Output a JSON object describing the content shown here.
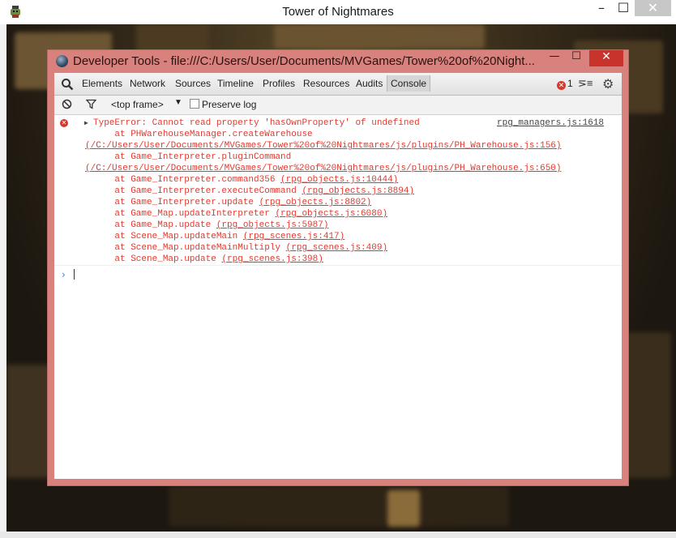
{
  "window": {
    "title": "Tower of Nightmares",
    "controls": {
      "minimize": "–",
      "maximize": "☐",
      "close": "✕"
    }
  },
  "devtools": {
    "title": "Developer Tools - file:///C:/Users/User/Documents/MVGames/Tower%20of%20Night...",
    "controls": {
      "minimize": "—",
      "maximize": "☐",
      "close": "✕"
    },
    "tabs": [
      "Elements",
      "Network",
      "Sources",
      "Timeline",
      "Profiles",
      "Resources",
      "Audits",
      "Console"
    ],
    "active_tab": "Console",
    "error_count": "1",
    "subtoolbar": {
      "frame": "<top frame>",
      "preserve_log": "Preserve log"
    },
    "console": {
      "error": {
        "message": "TypeError: Cannot read property 'hasOwnProperty' of undefined",
        "source": "rpg_managers.js:1618",
        "stack": [
          {
            "text": "    at PHWarehouseManager.createWarehouse",
            "link": ""
          },
          {
            "text": "",
            "link": "(/C:/Users/User/Documents/MVGames/Tower%20of%20Nightmares/js/plugins/PH_Warehouse.js:156)",
            "standalone": true
          },
          {
            "text": "    at Game_Interpreter.pluginCommand",
            "link": ""
          },
          {
            "text": "",
            "link": "(/C:/Users/User/Documents/MVGames/Tower%20of%20Nightmares/js/plugins/PH_Warehouse.js:650)",
            "standalone": true
          },
          {
            "text": "    at Game_Interpreter.command356 ",
            "link": "(rpg_objects.js:10444)"
          },
          {
            "text": "    at Game_Interpreter.executeCommand ",
            "link": "(rpg_objects.js:8894)"
          },
          {
            "text": "    at Game_Interpreter.update ",
            "link": "(rpg_objects.js:8802)"
          },
          {
            "text": "    at Game_Map.updateInterpreter ",
            "link": "(rpg_objects.js:6080)"
          },
          {
            "text": "    at Game_Map.update ",
            "link": "(rpg_objects.js:5987)"
          },
          {
            "text": "    at Scene_Map.updateMain ",
            "link": "(rpg_scenes.js:417)"
          },
          {
            "text": "    at Scene_Map.updateMainMultiply ",
            "link": "(rpg_scenes.js:409)"
          },
          {
            "text": "    at Scene_Map.update ",
            "link": "(rpg_scenes.js:398)"
          }
        ]
      },
      "prompt": "›"
    }
  },
  "colors": {
    "devtools_frame": "#d9817c",
    "error_text": "#e23a2f",
    "close_button": "#c8332b"
  }
}
